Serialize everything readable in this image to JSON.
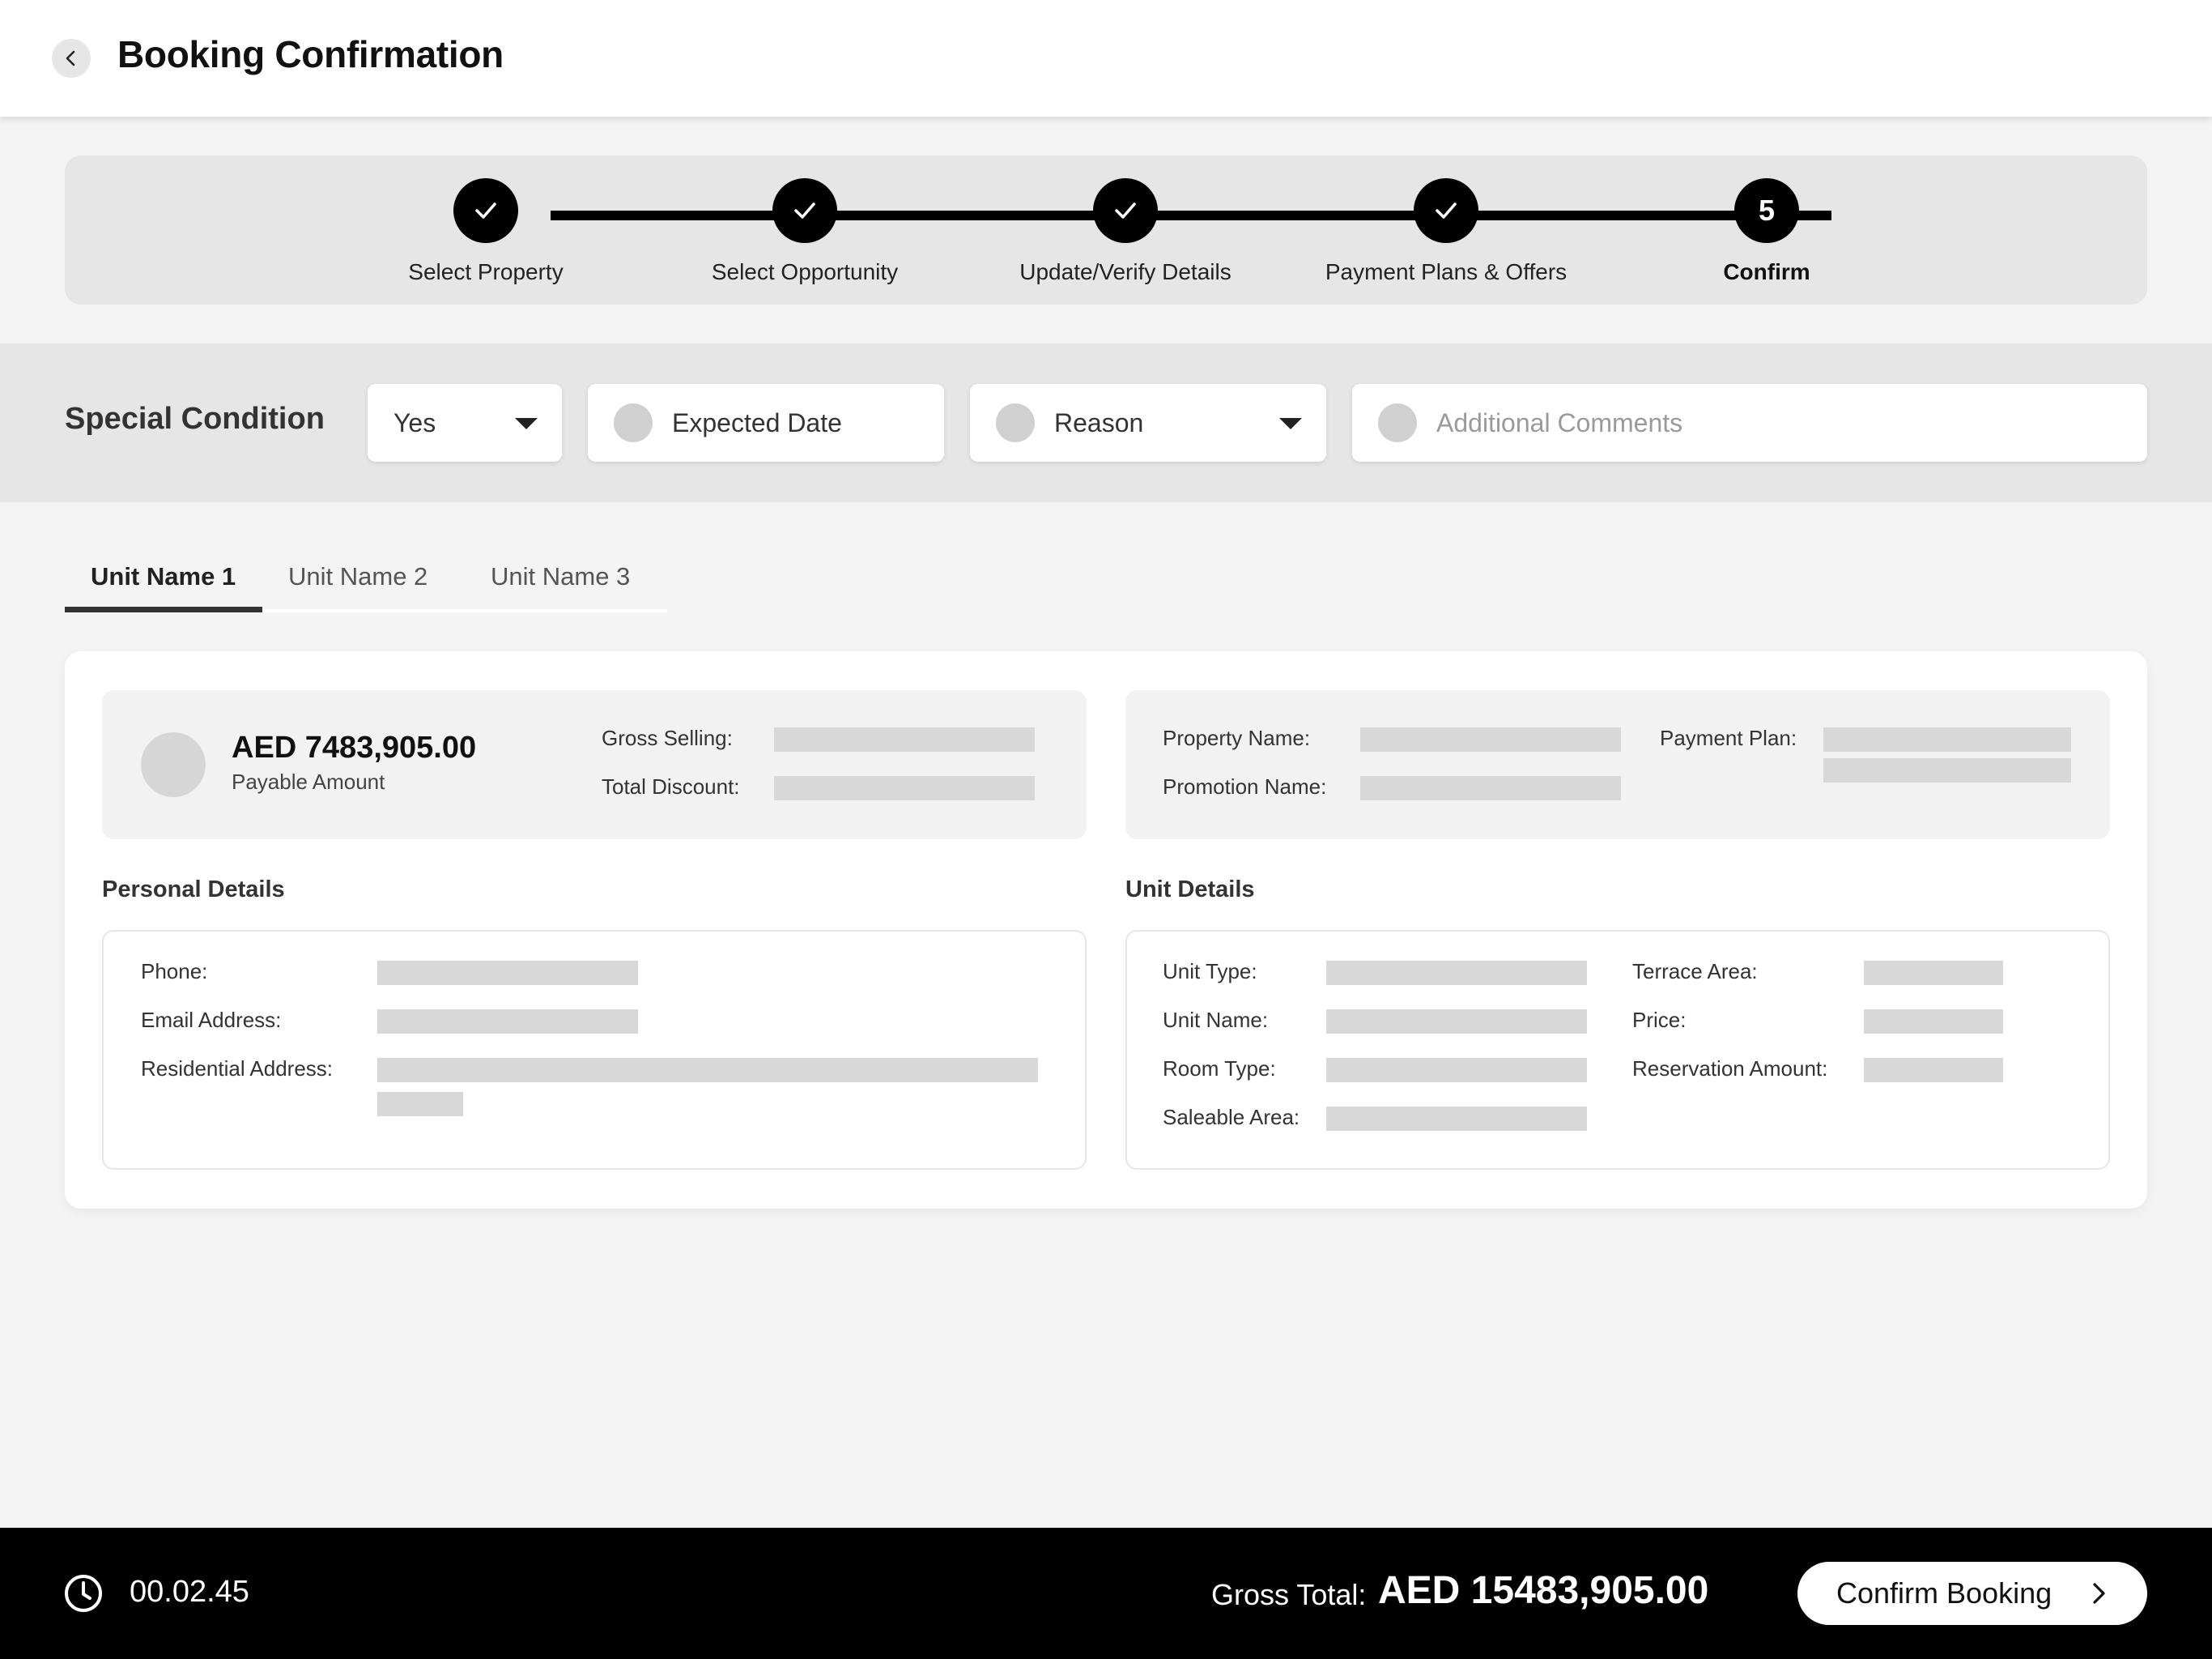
{
  "header": {
    "title": "Booking Confirmation",
    "back_icon": "chevron-left-icon"
  },
  "stepper": {
    "steps": [
      {
        "label": "Select Property",
        "state": "done",
        "mark": ""
      },
      {
        "label": "Select Opportunity",
        "state": "done",
        "mark": ""
      },
      {
        "label": "Update/Verify Details",
        "state": "done",
        "mark": ""
      },
      {
        "label": "Payment Plans & Offers",
        "state": "done",
        "mark": ""
      },
      {
        "label": "Confirm",
        "state": "active",
        "mark": "5"
      }
    ]
  },
  "special_condition": {
    "title": "Special Condition",
    "select_value": "Yes",
    "expected_date_placeholder": "Expected Date",
    "reason_placeholder": "Reason",
    "comments_placeholder": "Additional Comments"
  },
  "tabs": [
    "Unit Name 1",
    "Unit Name 2",
    "Unit Name 3"
  ],
  "summary": {
    "amount": "AED 7483,905.00",
    "amount_label": "Payable Amount",
    "gross_selling_label": "Gross Selling:",
    "total_discount_label": "Total Discount:",
    "property_name_label": "Property Name:",
    "promotion_name_label": "Promotion Name:",
    "payment_plan_label": "Payment Plan:"
  },
  "personal": {
    "title": "Personal Details",
    "phone_label": "Phone:",
    "email_label": "Email Address:",
    "address_label": "Residential Address:"
  },
  "unit": {
    "title": "Unit Details",
    "unit_type_label": "Unit Type:",
    "unit_name_label": "Unit Name:",
    "room_type_label": "Room Type:",
    "saleable_area_label": "Saleable Area:",
    "terrace_area_label": "Terrace Area:",
    "price_label": "Price:",
    "reservation_amount_label": "Reservation Amount:"
  },
  "footer": {
    "timer": "00.02.45",
    "gross_total_label": "Gross Total:",
    "gross_total_value": "AED 15483,905.00",
    "confirm_label": "Confirm Booking"
  }
}
